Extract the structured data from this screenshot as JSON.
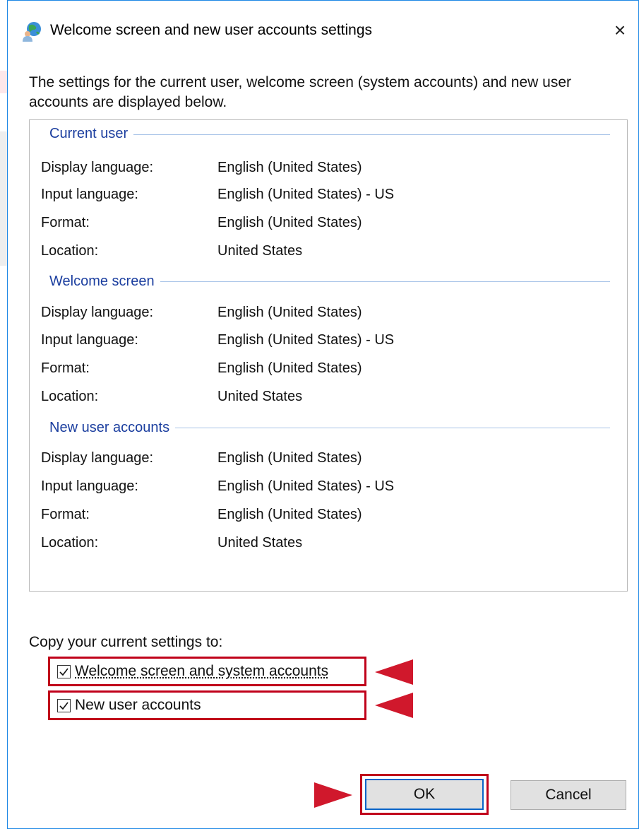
{
  "dialog": {
    "title": "Welcome screen and new user accounts settings",
    "title_icon": "globe-user-icon",
    "close_label": "×",
    "intro": "The settings for the current user, welcome screen (system accounts) and new user accounts are displayed below."
  },
  "groups": [
    {
      "heading": "Current user",
      "rows": [
        {
          "label": "Display language:",
          "value": "English (United States)"
        },
        {
          "label": "Input language:",
          "value": "English (United States) - US"
        },
        {
          "label": "Format:",
          "value": "English (United States)"
        },
        {
          "label": "Location:",
          "value": "United States"
        }
      ]
    },
    {
      "heading": "Welcome screen",
      "rows": [
        {
          "label": "Display language:",
          "value": "English (United States)"
        },
        {
          "label": "Input language:",
          "value": "English (United States) - US"
        },
        {
          "label": "Format:",
          "value": "English (United States)"
        },
        {
          "label": "Location:",
          "value": "United States"
        }
      ]
    },
    {
      "heading": "New user accounts",
      "rows": [
        {
          "label": "Display language:",
          "value": "English (United States)"
        },
        {
          "label": "Input language:",
          "value": "English (United States) - US"
        },
        {
          "label": "Format:",
          "value": "English (United States)"
        },
        {
          "label": "Location:",
          "value": "United States"
        }
      ]
    }
  ],
  "copy": {
    "label": "Copy your current settings to:",
    "options": [
      {
        "label": "Welcome screen and system accounts",
        "checked": true
      },
      {
        "label": "New user accounts",
        "checked": true
      }
    ]
  },
  "buttons": {
    "ok": "OK",
    "cancel": "Cancel"
  },
  "colors": {
    "highlight": "#c0001a",
    "group_heading": "#1b3e9f",
    "focus_border": "#0a64c8"
  }
}
